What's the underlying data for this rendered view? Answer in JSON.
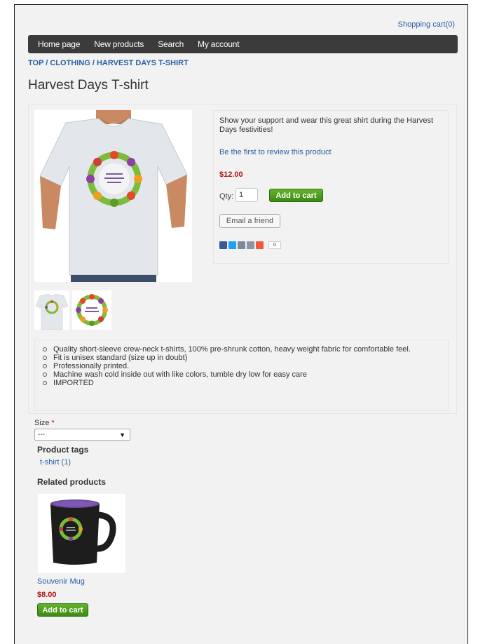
{
  "header": {
    "cart_link": "Shopping cart(0)"
  },
  "nav": {
    "items": [
      "Home page",
      "New products",
      "Search",
      "My account"
    ]
  },
  "breadcrumb": "TOP / CLOTHING / HARVEST DAYS T-SHIRT",
  "product": {
    "title": "Harvest Days T-shirt",
    "description": "Show your support and wear this great shirt during the Harvest Days festivities!",
    "review_link": "Be the first to review this product",
    "price": "$12.00",
    "qty_label": "Qty:",
    "qty_value": "1",
    "add_to_cart_label": "Add to cart",
    "email_friend_label": "Email a friend",
    "share_count": "0",
    "features": [
      "Quality short-sleeve crew-neck t-shirts, 100% pre-shrunk cotton, heavy weight fabric for comfortable feel.",
      "Fit is unisex standard (size up in doubt)",
      "Professionally printed.",
      "Machine wash cold inside out with like colors, tumble dry low for easy care",
      "IMPORTED"
    ],
    "size_label": "Size",
    "size_required_mark": "*",
    "size_selected": "---"
  },
  "tags": {
    "title": "Product tags",
    "items": [
      "t-shirt (1)"
    ]
  },
  "related": {
    "title": "Related products",
    "items": [
      {
        "name": "Souvenir Mug",
        "price": "$8.00",
        "add_to_cart_label": "Add to cart"
      }
    ]
  },
  "colors": {
    "accent_green": "#4a9c1c",
    "price_red": "#b11313",
    "link_blue": "#2a5ea4",
    "nav_bg": "#3b3b3b"
  }
}
